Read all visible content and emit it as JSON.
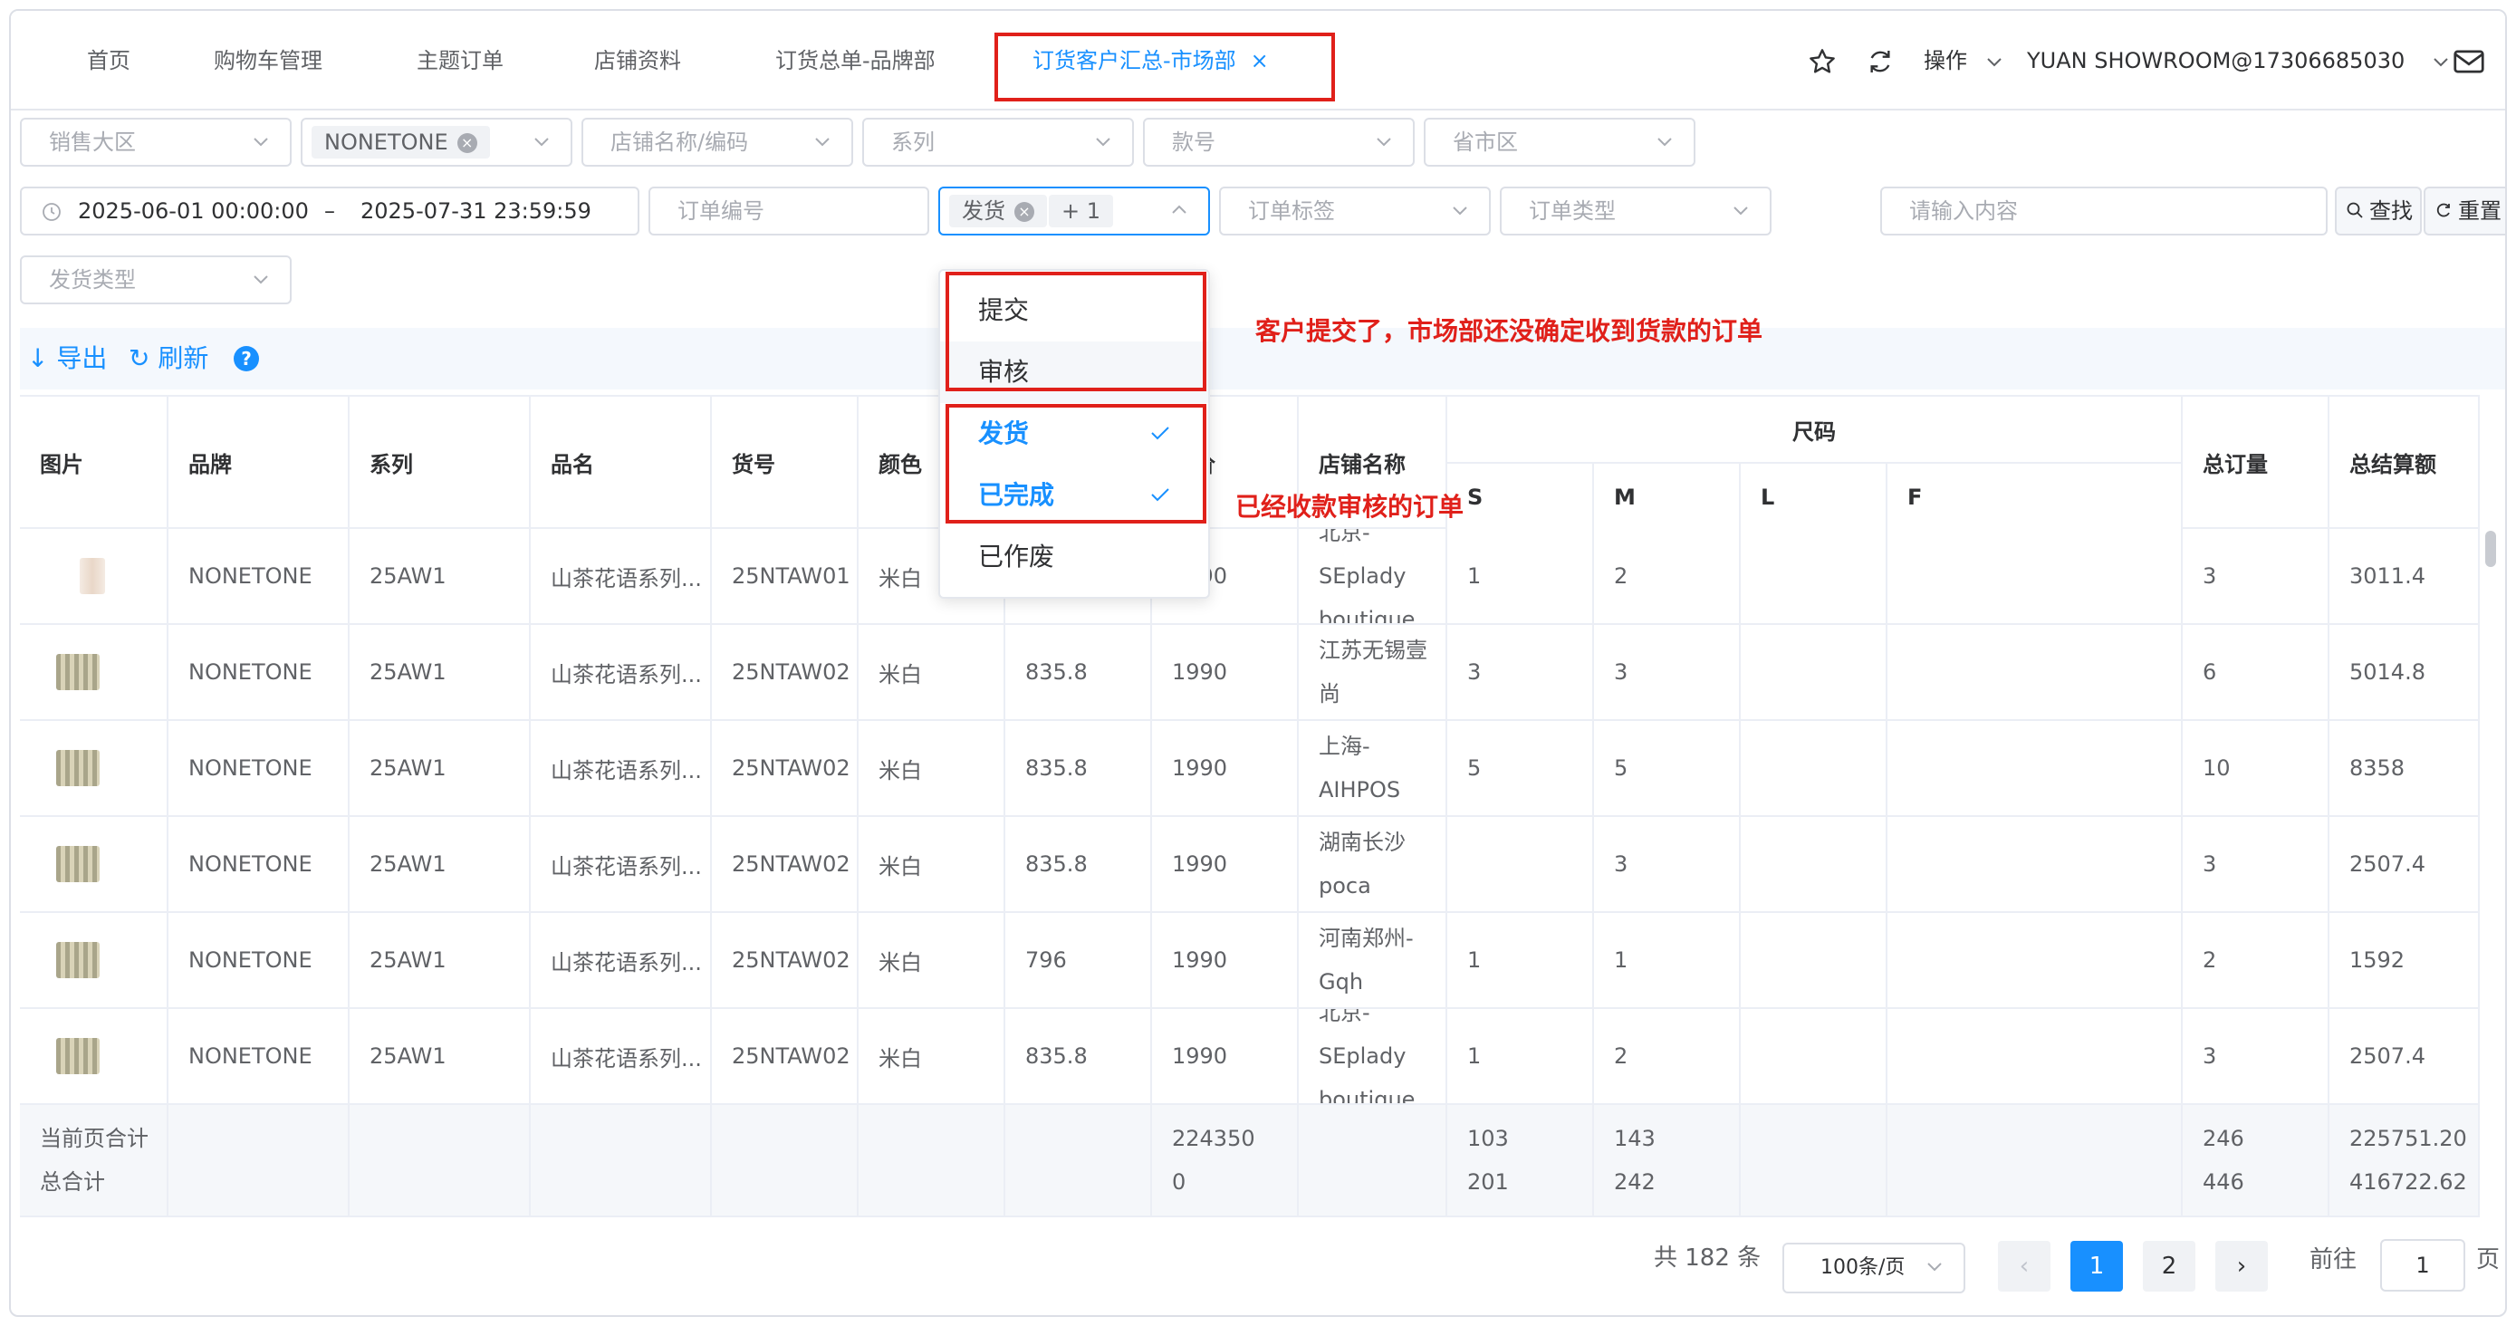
{
  "tabs": [
    {
      "label": "首页"
    },
    {
      "label": "购物车管理"
    },
    {
      "label": "主题订单"
    },
    {
      "label": "店铺资料"
    },
    {
      "label": "订货总单-品牌部"
    },
    {
      "label": "订货客户汇总-市场部",
      "close": "×"
    }
  ],
  "header": {
    "action_label": "操作",
    "user": "YUAN SHOWROOM@17306685030"
  },
  "filters": {
    "region": "销售大区",
    "brand_tag": "NONETONE",
    "store": "店铺名称/编码",
    "series": "系列",
    "style_no": "款号",
    "province": "省市区",
    "date_start": "2025-06-01 00:00:00",
    "date_sep": "–",
    "date_end": "2025-07-31 23:59:59",
    "order_no": "订单编号",
    "status_tag": "发货",
    "status_more": "+ 1",
    "order_tag": "订单标签",
    "order_type": "订单类型",
    "search_input": "请输入内容",
    "search_btn": "查找",
    "reset_btn": "重置",
    "ship_type": "发货类型"
  },
  "toolbar": {
    "export": "导出",
    "refresh": "刷新",
    "help": "?"
  },
  "table": {
    "headers": {
      "img": "图片",
      "brand": "品牌",
      "series": "系列",
      "name": "品名",
      "sku": "货号",
      "color": "颜色",
      "retail": "售价",
      "store": "店铺名称",
      "size": "尺码",
      "s": "S",
      "m": "M",
      "l": "L",
      "f": "F",
      "qty": "总订量",
      "amount": "总结算额"
    },
    "rows": [
      {
        "brand": "NONETONE",
        "series": "25AW1",
        "name": "山茶花语系列...",
        "sku": "25NTAW01",
        "color": "米白",
        "price": "",
        "retail": "1990",
        "store": "北京-SEplady boutique",
        "s": "1",
        "m": "2",
        "l": "",
        "f": "",
        "qty": "3",
        "amount": "3011.4"
      },
      {
        "brand": "NONETONE",
        "series": "25AW1",
        "name": "山茶花语系列...",
        "sku": "25NTAW02",
        "color": "米白",
        "price": "835.8",
        "retail": "1990",
        "store": "江苏无锡壹尚",
        "s": "3",
        "m": "3",
        "l": "",
        "f": "",
        "qty": "6",
        "amount": "5014.8"
      },
      {
        "brand": "NONETONE",
        "series": "25AW1",
        "name": "山茶花语系列...",
        "sku": "25NTAW02",
        "color": "米白",
        "price": "835.8",
        "retail": "1990",
        "store": "上海-AIHPOS",
        "s": "5",
        "m": "5",
        "l": "",
        "f": "",
        "qty": "10",
        "amount": "8358"
      },
      {
        "brand": "NONETONE",
        "series": "25AW1",
        "name": "山茶花语系列...",
        "sku": "25NTAW02",
        "color": "米白",
        "price": "835.8",
        "retail": "1990",
        "store": "湖南长沙poca",
        "s": "",
        "m": "3",
        "l": "",
        "f": "",
        "qty": "3",
        "amount": "2507.4"
      },
      {
        "brand": "NONETONE",
        "series": "25AW1",
        "name": "山茶花语系列...",
        "sku": "25NTAW02",
        "color": "米白",
        "price": "796",
        "retail": "1990",
        "store": "河南郑州-Gqh",
        "s": "1",
        "m": "1",
        "l": "",
        "f": "",
        "qty": "2",
        "amount": "1592"
      },
      {
        "brand": "NONETONE",
        "series": "25AW1",
        "name": "山茶花语系列...",
        "sku": "25NTAW02",
        "color": "米白",
        "price": "835.8",
        "retail": "1990",
        "store": "北京-SEplady boutique",
        "s": "1",
        "m": "2",
        "l": "",
        "f": "",
        "qty": "3",
        "amount": "2507.4"
      }
    ],
    "summary": {
      "label1": "当前页合计",
      "label2": "总合计",
      "retail1": "224350",
      "retail2": "0",
      "s1": "103",
      "s2": "201",
      "m1": "143",
      "m2": "242",
      "qty1": "246",
      "qty2": "446",
      "amount1": "225751.20",
      "amount2": "416722.62"
    }
  },
  "dropdown": {
    "items": [
      {
        "label": "提交",
        "selected": false
      },
      {
        "label": "审核",
        "selected": false
      },
      {
        "label": "发货",
        "selected": true
      },
      {
        "label": "已完成",
        "selected": true
      },
      {
        "label": "已作废",
        "selected": false
      }
    ]
  },
  "annotations": {
    "top": "客户提交了，市场部还没确定收到货款的订单",
    "bottom": "已经收款审核的订单"
  },
  "pagination": {
    "total": "共 182 条",
    "page_size": "100条/页",
    "pages": [
      "1",
      "2"
    ],
    "prev": "‹",
    "next": "›",
    "goto_label": "前往",
    "goto_value": "1",
    "page_suffix": "页"
  },
  "colors": {
    "accent": "#1890ff",
    "annotation_red": "#e0201a"
  }
}
